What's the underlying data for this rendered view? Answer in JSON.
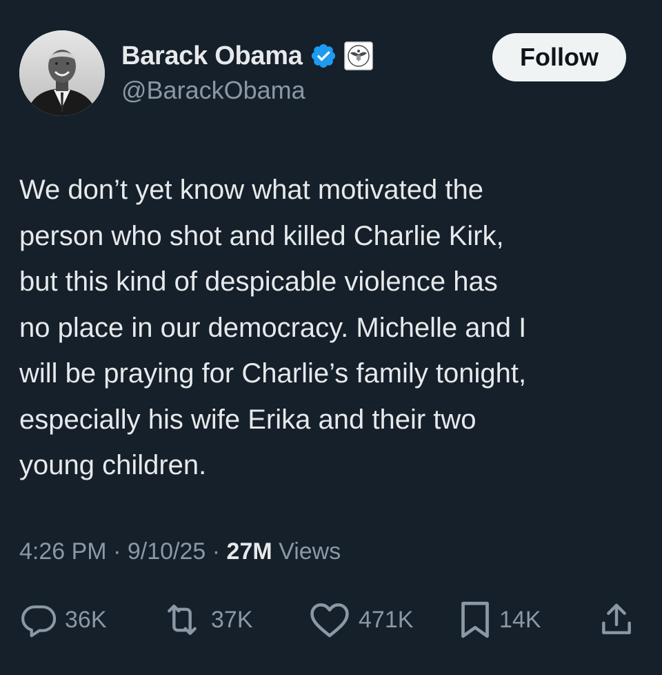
{
  "author": {
    "display_name": "Barack Obama",
    "handle": "@BarackObama",
    "verified_icon": "verified-badge-icon",
    "affiliation_icon": "government-seal-icon"
  },
  "follow_label": "Follow",
  "post": {
    "lines": [
      "We don’t yet know what motivated the",
      "person who shot and killed Charlie Kirk,",
      "but this kind of despicable violence has",
      "no place in our democracy. Michelle and I",
      "will be praying for Charlie’s family tonight,",
      "especially his wife Erika and their two",
      "young children."
    ]
  },
  "meta": {
    "time": "4:26 PM",
    "date": "9/10/25",
    "separator": "·",
    "views_count": "27M",
    "views_label": "Views"
  },
  "actions": {
    "replies": "36K",
    "reposts": "37K",
    "likes": "471K",
    "bookmarks": "14K"
  },
  "colors": {
    "background": "#15202b",
    "text": "#e7e9ea",
    "secondary": "#8b98a5",
    "verified": "#1d9bf0",
    "follow_bg": "#eff3f4"
  }
}
